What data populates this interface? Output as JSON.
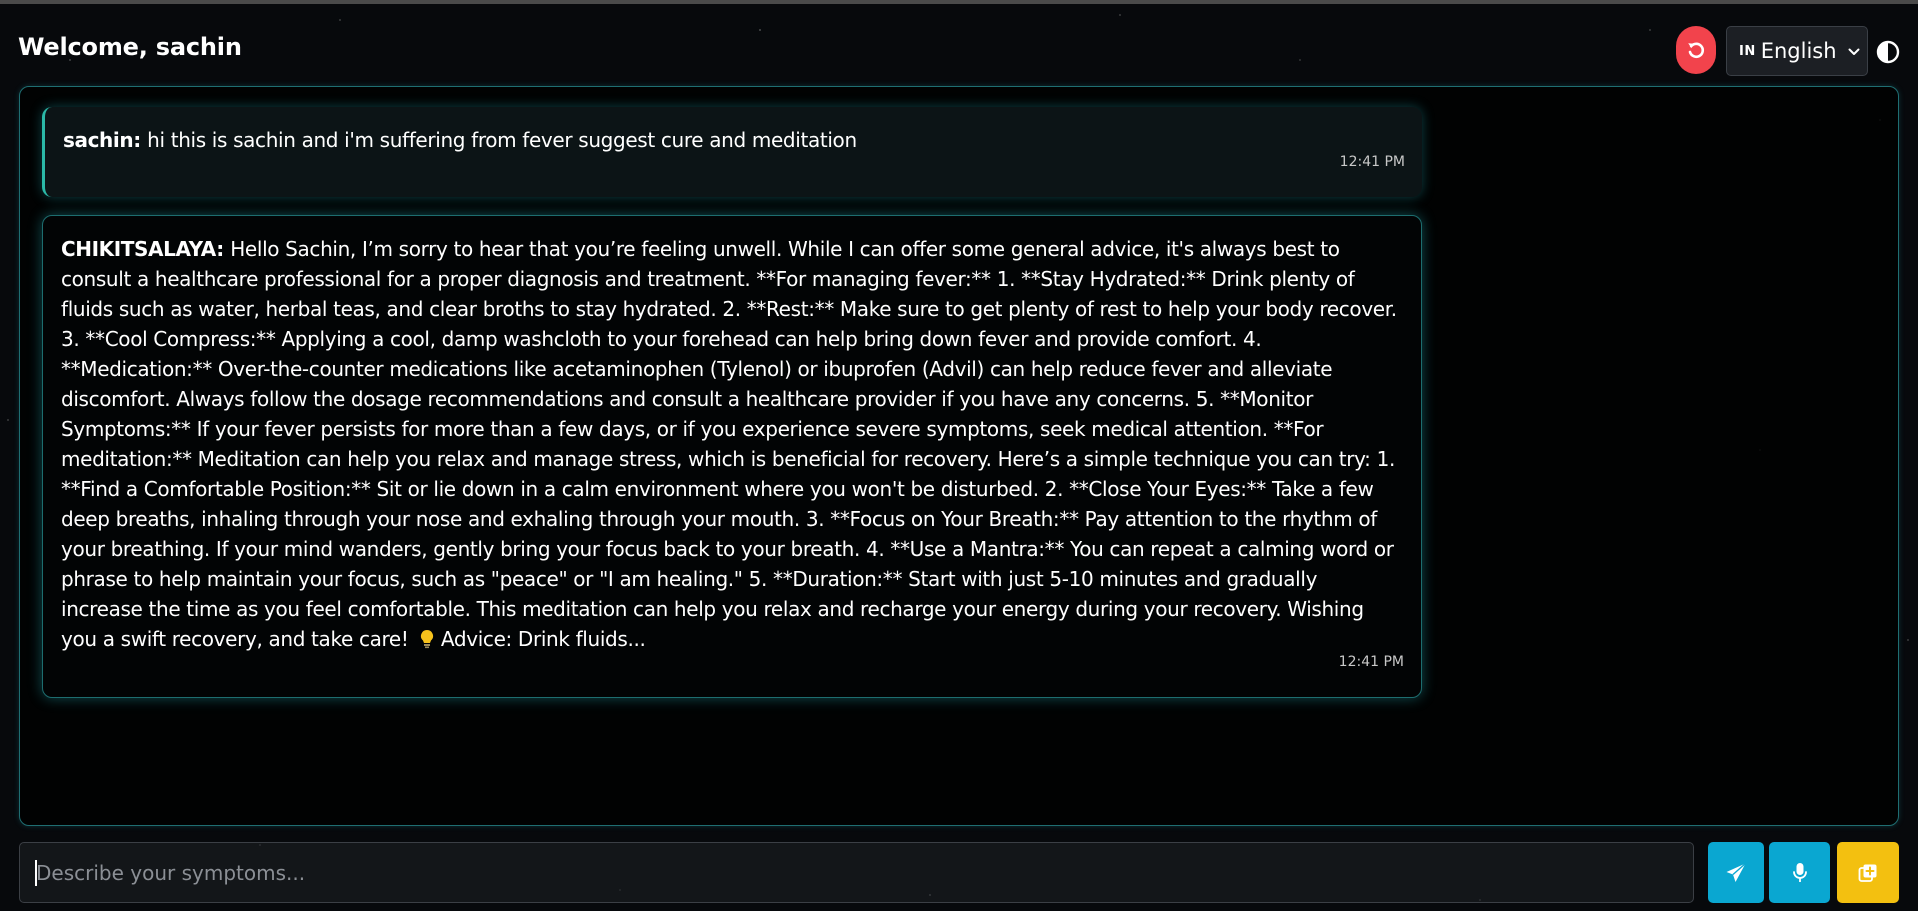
{
  "header": {
    "welcome": "Welcome, sachin",
    "reset_icon": "refresh-icon",
    "language": {
      "flag": "IN",
      "selected": "English"
    },
    "theme_icon": "contrast-icon"
  },
  "chat": {
    "messages": [
      {
        "sender": "sachin:",
        "text": "hi this is sachin and i'm suffering from fever suggest cure and meditation",
        "time": "12:41 PM"
      },
      {
        "sender": "CHIKITSALAYA:",
        "text": "Hello Sachin, I’m sorry to hear that you’re feeling unwell. While I can offer some general advice, it's always best to consult a healthcare professional for a proper diagnosis and treatment. **For managing fever:** 1. **Stay Hydrated:** Drink plenty of fluids such as water, herbal teas, and clear broths to stay hydrated. 2. **Rest:** Make sure to get plenty of rest to help your body recover. 3. **Cool Compress:** Applying a cool, damp washcloth to your forehead can help bring down fever and provide comfort. 4. **Medication:** Over-the-counter medications like acetaminophen (Tylenol) or ibuprofen (Advil) can help reduce fever and alleviate discomfort. Always follow the dosage recommendations and consult a healthcare provider if you have any concerns. 5. **Monitor Symptoms:** If your fever persists for more than a few days, or if you experience severe symptoms, seek medical attention. **For meditation:** Meditation can help you relax and manage stress, which is beneficial for recovery. Here’s a simple technique you can try: 1. **Find a Comfortable Position:** Sit or lie down in a calm environment where you won't be disturbed. 2. **Close Your Eyes:** Take a few deep breaths, inhaling through your nose and exhaling through your mouth. 3. **Focus on Your Breath:** Pay attention to the rhythm of your breathing. If your mind wanders, gently bring your focus back to your breath. 4. **Use a Mantra:** You can repeat a calming word or phrase to help maintain your focus, such as \"peace\" or \"I am healing.\" 5. **Duration:** Start with just 5-10 minutes and gradually increase the time as you feel comfortable. This meditation can help you relax and recharge your energy during your recovery. Wishing you a swift recovery, and take care!",
        "advice_icon": "lightbulb-icon",
        "advice": "Advice: Drink fluids...",
        "time": "12:41 PM"
      }
    ]
  },
  "composer": {
    "placeholder": "Describe your symptoms...",
    "value": "",
    "send_icon": "paper-plane-icon",
    "mic_icon": "microphone-icon",
    "add_icon": "add-copy-icon"
  },
  "colors": {
    "reset_button": "#f2434c",
    "send_button": "#0aa7d1",
    "mic_button": "#0aa7d1",
    "add_button": "#f3c010",
    "accent_glow": "#2bb9a8"
  }
}
